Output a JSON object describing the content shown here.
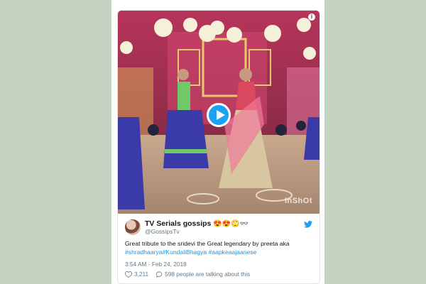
{
  "tweet": {
    "author": {
      "display_name": "TV Serials gossips",
      "emojis": "😍😍🙄👓",
      "handle": "@GossipsTv"
    },
    "text_line1": "Great tribute to the sridevi the Great legendary by preeta aka",
    "hashtags": [
      "#shradhaarya",
      "#KundaliBhagya",
      "#aapkeaajaanese"
    ],
    "timestamp": "3:54 AM - Feb 24, 2018",
    "likes": "3,211",
    "talking": "598 people are talking about this"
  },
  "video": {
    "watermark": "InShOt",
    "info_icon": "i"
  },
  "icons": {
    "play": "play-icon",
    "info": "info-icon",
    "twitter": "twitter-bird-icon",
    "like": "heart-icon",
    "reply": "comment-bubble-icon"
  },
  "colors": {
    "background": "#c5d4c0",
    "twitter_blue": "#1da1f2",
    "hashtag": "#1b95e0",
    "text": "#14171a",
    "muted": "#657786"
  }
}
